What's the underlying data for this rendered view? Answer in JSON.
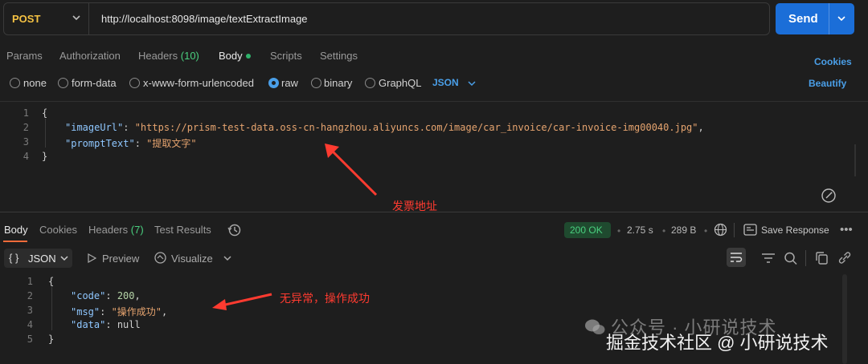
{
  "request": {
    "method": "POST",
    "url": "http://localhost:8098/image/textExtractImage",
    "send_label": "Send"
  },
  "request_tabs": [
    "Params",
    "Authorization",
    "Headers",
    "(10)",
    "Body",
    "Scripts",
    "Settings"
  ],
  "cookies_label": "Cookies",
  "body_types": [
    "none",
    "form-data",
    "x-www-form-urlencoded",
    "raw",
    "binary",
    "GraphQL"
  ],
  "selected_body_type": "raw",
  "format": "JSON",
  "beautify_label": "Beautify",
  "request_body": {
    "line_numbers": [
      "1",
      "2",
      "3",
      "4"
    ],
    "open_brace": "{",
    "close_brace": "}",
    "key1": "\"imageUrl\"",
    "val1": "\"https://prism-test-data.oss-cn-hangzhou.aliyuncs.com/image/car_invoice/car-invoice-img00040.jpg\"",
    "key2": "\"promptText\"",
    "val2": "\"提取文字\""
  },
  "annotations": {
    "request": "发票地址",
    "response": "无异常，操作成功",
    "color": "#ff3b30"
  },
  "response_tabs": [
    "Body",
    "Cookies",
    "Headers",
    "(7)",
    "Test Results"
  ],
  "response_status": {
    "status": "200 OK",
    "time": "2.75 s",
    "size": "289 B",
    "save_label": "Save Response",
    "more": "•••"
  },
  "response_toolbar": {
    "braces": "{ }",
    "format": "JSON",
    "preview": "Preview",
    "visualize": "Visualize"
  },
  "response_body": {
    "line_numbers": [
      "1",
      "2",
      "3",
      "4",
      "5"
    ],
    "open_brace": "{",
    "close_brace": "}",
    "key1": "\"code\"",
    "val1": "200",
    "key2": "\"msg\"",
    "val2": "\"操作成功\"",
    "key3": "\"data\"",
    "val3": "null"
  },
  "watermark": {
    "line1": "公众号 · 小研说技术",
    "line2": "掘金技术社区 @ 小研说技术"
  },
  "colors": {
    "accent": "#1b6ed8",
    "link": "#4a9fe8",
    "method": "#f5c243",
    "status_ok": "#4ad07f",
    "tab_active_underline": "#f26b3a"
  }
}
